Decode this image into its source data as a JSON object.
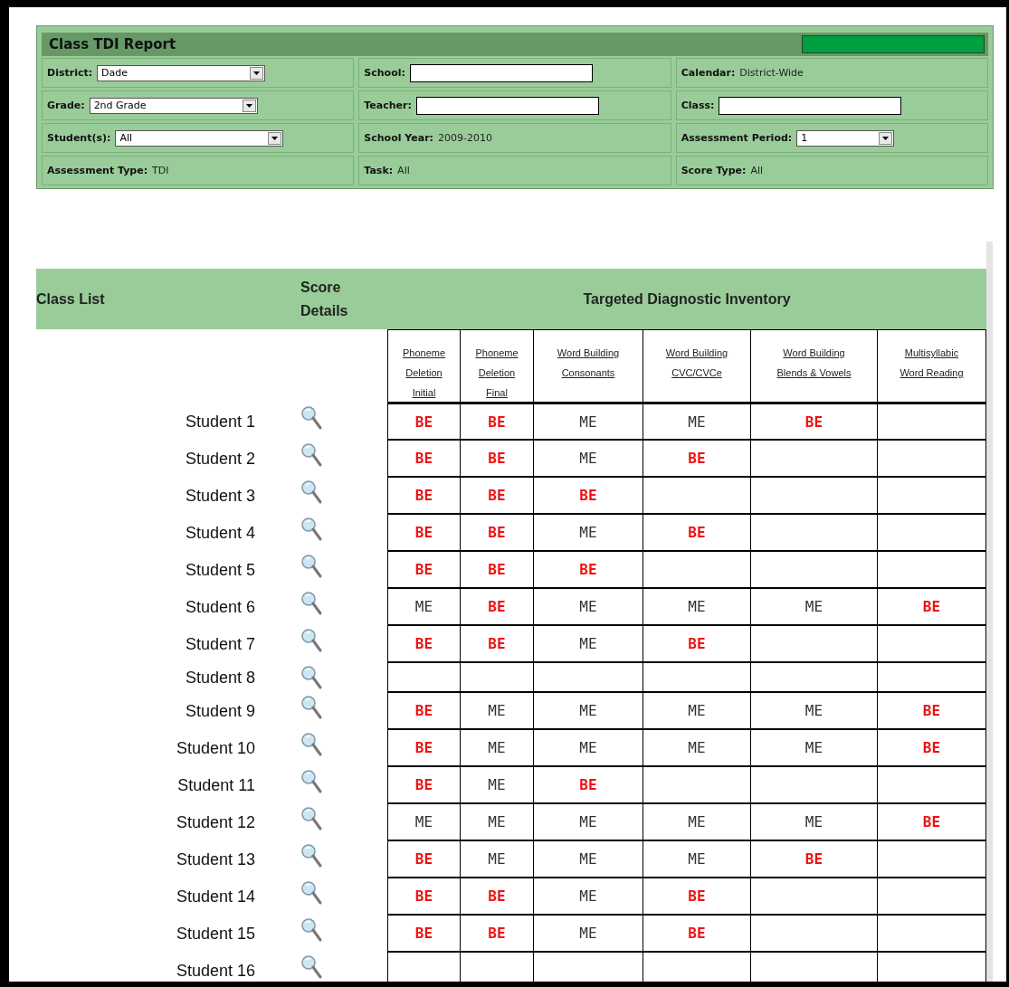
{
  "report_panel": {
    "title": "Class TDI Report",
    "fields": [
      {
        "label": "District:",
        "kind": "select",
        "value": "Dade"
      },
      {
        "label": "School:",
        "kind": "input"
      },
      {
        "label": "Calendar:",
        "kind": "text",
        "value": "District-Wide"
      },
      {
        "label": "Grade:",
        "kind": "select",
        "value": "2nd Grade"
      },
      {
        "label": "Teacher:",
        "kind": "input"
      },
      {
        "label": "Class:",
        "kind": "input"
      },
      {
        "label": "Student(s):",
        "kind": "select",
        "value": "All"
      },
      {
        "label": "School Year:",
        "kind": "text",
        "value": "2009-2010"
      },
      {
        "label": "Assessment Period:",
        "kind": "select",
        "value": "1"
      },
      {
        "label": "Assessment Type:",
        "kind": "text",
        "value": "TDI"
      },
      {
        "label": "Task:",
        "kind": "text",
        "value": "All"
      },
      {
        "label": "Score Type:",
        "kind": "text",
        "value": "All"
      }
    ]
  },
  "table": {
    "class_list_header": "Class List",
    "score_details_header": "Score Details",
    "inventory_header": "Targeted Diagnostic Inventory",
    "columns": [
      "Phoneme Deletion Initial",
      "Phoneme Deletion Final",
      "Word Building Consonants",
      "Word Building CVC/CVCe",
      "Word Building Blends & Vowels",
      "Multisyllabic Word Reading"
    ],
    "rows": [
      {
        "student": "Student 1",
        "scores": {
          "deletion_initial": {
            "text": "BE",
            "kind": "below"
          },
          "deletion_final": {
            "text": "BE",
            "kind": "below"
          },
          "consonants": {
            "text": "ME",
            "kind": "meets"
          },
          "cvc": {
            "text": "ME",
            "kind": "meets"
          },
          "blends": {
            "text": "BE",
            "kind": "below"
          }
        }
      },
      {
        "student": "Student 2",
        "scores": {
          "deletion_initial": {
            "text": "BE",
            "kind": "below"
          },
          "deletion_final": {
            "text": "BE",
            "kind": "below"
          },
          "consonants": {
            "text": "ME",
            "kind": "meets"
          },
          "cvc": {
            "text": "BE",
            "kind": "below"
          }
        }
      },
      {
        "student": "Student 3",
        "scores": {
          "deletion_initial": {
            "text": "BE",
            "kind": "below"
          },
          "deletion_final": {
            "text": "BE",
            "kind": "below"
          },
          "consonants": {
            "text": "BE",
            "kind": "below"
          }
        }
      },
      {
        "student": "Student 4",
        "scores": {
          "deletion_initial": {
            "text": "BE",
            "kind": "below"
          },
          "deletion_final": {
            "text": "BE",
            "kind": "below"
          },
          "consonants": {
            "text": "ME",
            "kind": "meets"
          },
          "cvc": {
            "text": "BE",
            "kind": "below"
          }
        }
      },
      {
        "student": "Student 5",
        "scores": {
          "deletion_initial": {
            "text": "BE",
            "kind": "below"
          },
          "deletion_final": {
            "text": "BE",
            "kind": "below"
          },
          "consonants": {
            "text": "BE",
            "kind": "below"
          }
        }
      },
      {
        "student": "Student 6",
        "scores": {
          "deletion_initial": {
            "text": "ME",
            "kind": "meets"
          },
          "deletion_final": {
            "text": "BE",
            "kind": "below"
          },
          "consonants": {
            "text": "ME",
            "kind": "meets"
          },
          "cvc": {
            "text": "ME",
            "kind": "meets"
          },
          "blends": {
            "text": "ME",
            "kind": "meets"
          },
          "multisyllabic": {
            "text": "BE",
            "kind": "below"
          }
        }
      },
      {
        "student": "Student 7",
        "scores": {
          "deletion_initial": {
            "text": "BE",
            "kind": "below"
          },
          "deletion_final": {
            "text": "BE",
            "kind": "below"
          },
          "consonants": {
            "text": "ME",
            "kind": "meets"
          },
          "cvc": {
            "text": "BE",
            "kind": "below"
          }
        }
      },
      {
        "student": "Student 8"
      },
      {
        "student": "Student 9",
        "scores": {
          "deletion_initial": {
            "text": "BE",
            "kind": "below"
          },
          "deletion_final": {
            "text": "ME",
            "kind": "meets"
          },
          "consonants": {
            "text": "ME",
            "kind": "meets"
          },
          "cvc": {
            "text": "ME",
            "kind": "meets"
          },
          "blends": {
            "text": "ME",
            "kind": "meets"
          },
          "multisyllabic": {
            "text": "BE",
            "kind": "below"
          }
        }
      },
      {
        "student": "Student 10",
        "scores": {
          "deletion_initial": {
            "text": "BE",
            "kind": "below"
          },
          "deletion_final": {
            "text": "ME",
            "kind": "meets"
          },
          "consonants": {
            "text": "ME",
            "kind": "meets"
          },
          "cvc": {
            "text": "ME",
            "kind": "meets"
          },
          "blends": {
            "text": "ME",
            "kind": "meets"
          },
          "multisyllabic": {
            "text": "BE",
            "kind": "below"
          }
        }
      },
      {
        "student": "Student 11",
        "scores": {
          "deletion_initial": {
            "text": "BE",
            "kind": "below"
          },
          "deletion_final": {
            "text": "ME",
            "kind": "meets"
          },
          "consonants": {
            "text": "BE",
            "kind": "below"
          }
        }
      },
      {
        "student": "Student 12",
        "scores": {
          "deletion_initial": {
            "text": "ME",
            "kind": "meets"
          },
          "deletion_final": {
            "text": "ME",
            "kind": "meets"
          },
          "consonants": {
            "text": "ME",
            "kind": "meets"
          },
          "cvc": {
            "text": "ME",
            "kind": "meets"
          },
          "blends": {
            "text": "ME",
            "kind": "meets"
          },
          "multisyllabic": {
            "text": "BE",
            "kind": "below"
          }
        }
      },
      {
        "student": "Student 13",
        "scores": {
          "deletion_initial": {
            "text": "BE",
            "kind": "below"
          },
          "deletion_final": {
            "text": "ME",
            "kind": "meets"
          },
          "consonants": {
            "text": "ME",
            "kind": "meets"
          },
          "cvc": {
            "text": "ME",
            "kind": "meets"
          },
          "blends": {
            "text": "BE",
            "kind": "below"
          }
        }
      },
      {
        "student": "Student 14",
        "scores": {
          "deletion_initial": {
            "text": "BE",
            "kind": "below"
          },
          "deletion_final": {
            "text": "BE",
            "kind": "below"
          },
          "consonants": {
            "text": "ME",
            "kind": "meets"
          },
          "cvc": {
            "text": "BE",
            "kind": "below"
          }
        }
      },
      {
        "student": "Student 15",
        "scores": {
          "deletion_initial": {
            "text": "BE",
            "kind": "below"
          },
          "deletion_final": {
            "text": "BE",
            "kind": "below"
          },
          "consonants": {
            "text": "ME",
            "kind": "meets"
          },
          "cvc": {
            "text": "BE",
            "kind": "below"
          }
        }
      },
      {
        "student": "Student 16"
      }
    ]
  }
}
